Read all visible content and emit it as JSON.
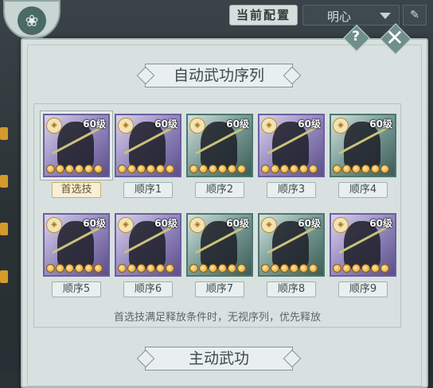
{
  "topbar": {
    "config_tab_label": "当前配置",
    "config_select_value": "明心",
    "edit_icon": "pencil-icon",
    "emblem_icon": "lotus-icon"
  },
  "panel": {
    "title": "自动武功序列",
    "section2_title": "主动武功",
    "note": "首选技满足释放条件时，无视序列，优先释放",
    "help_label": "?",
    "close_label": "✕"
  },
  "skills": [
    {
      "level": "60级",
      "label": "首选技",
      "theme": "purple",
      "selected": true
    },
    {
      "level": "60级",
      "label": "顺序1",
      "theme": "purple",
      "selected": false
    },
    {
      "level": "60级",
      "label": "顺序2",
      "theme": "green",
      "selected": false
    },
    {
      "level": "60级",
      "label": "顺序3",
      "theme": "purple",
      "selected": false
    },
    {
      "level": "60级",
      "label": "顺序4",
      "theme": "green",
      "selected": false
    },
    {
      "level": "60级",
      "label": "顺序5",
      "theme": "purple",
      "selected": false
    },
    {
      "level": "60级",
      "label": "顺序6",
      "theme": "purple",
      "selected": false
    },
    {
      "level": "60级",
      "label": "顺序7",
      "theme": "green",
      "selected": false
    },
    {
      "level": "60级",
      "label": "顺序8",
      "theme": "green",
      "selected": false
    },
    {
      "level": "60级",
      "label": "顺序9",
      "theme": "purple",
      "selected": false
    }
  ]
}
